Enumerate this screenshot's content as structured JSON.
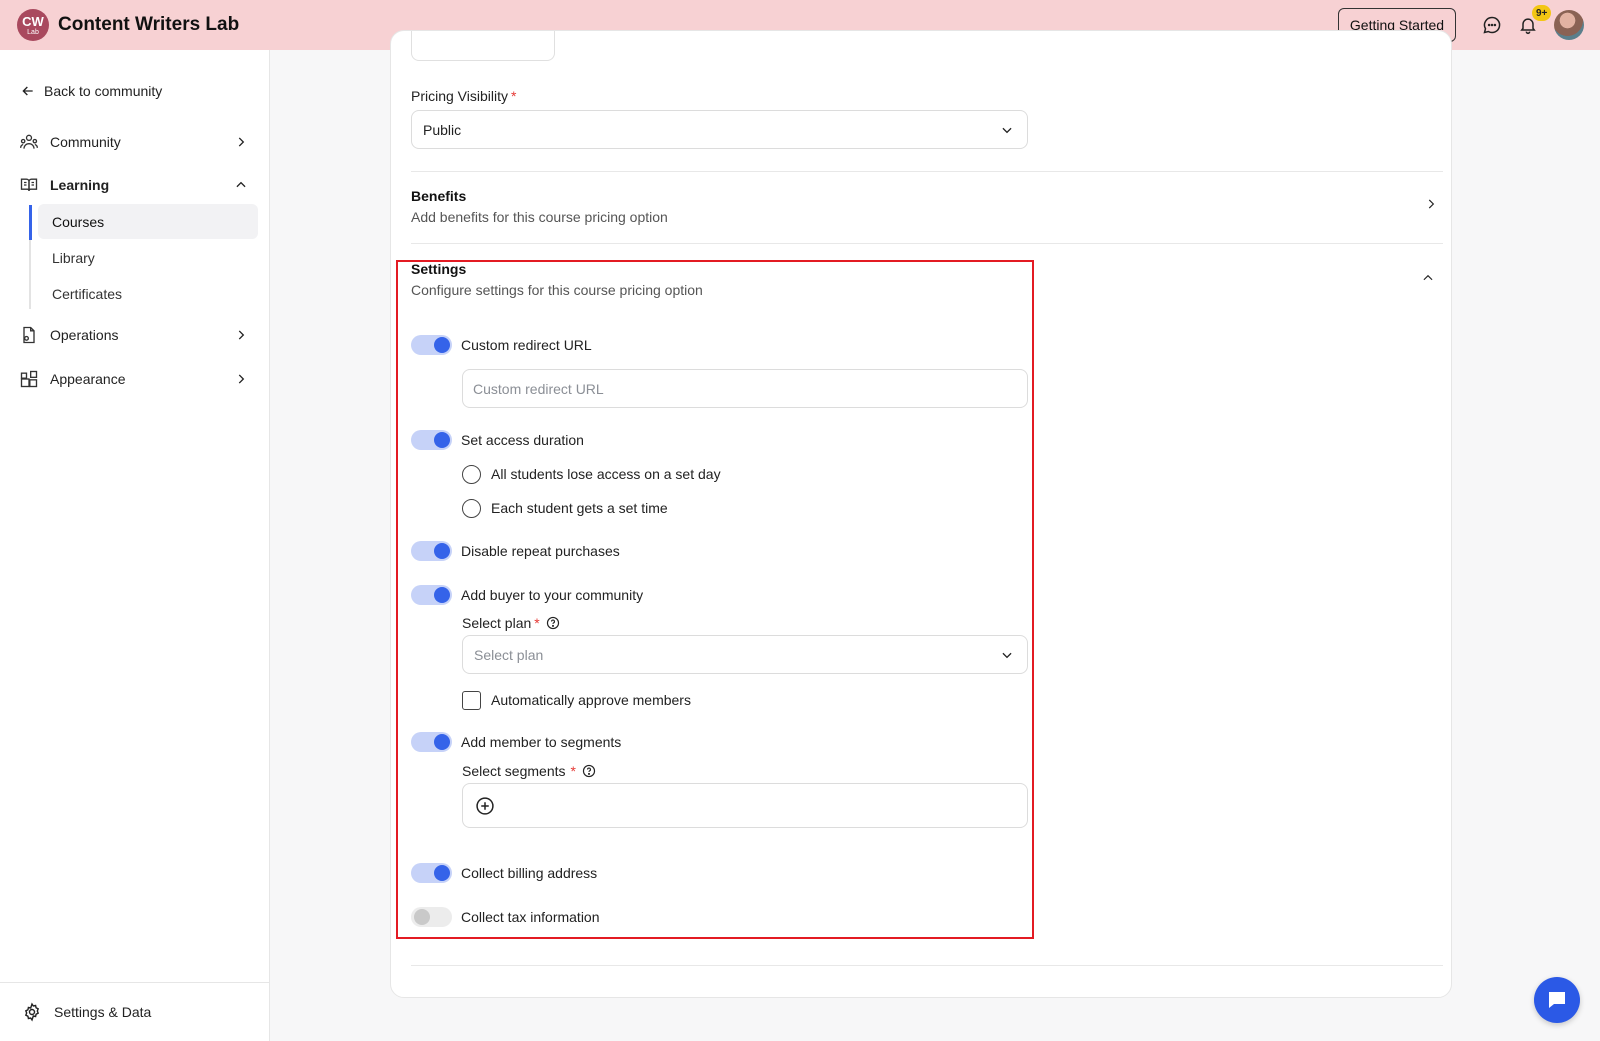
{
  "header": {
    "logo_line1": "CW",
    "logo_line2": "Lab",
    "app_title": "Content Writers Lab",
    "getting_started_label": "Getting Started",
    "notification_badge": "9+"
  },
  "sidebar": {
    "back_label": "Back to community",
    "items": {
      "community": "Community",
      "learning": "Learning",
      "operations": "Operations",
      "appearance": "Appearance"
    },
    "learning_sub": {
      "courses": "Courses",
      "library": "Library",
      "certificates": "Certificates"
    },
    "settings_label": "Settings & Data"
  },
  "form": {
    "pricing_visibility": {
      "label": "Pricing Visibility",
      "required_mark": "*",
      "value": "Public"
    },
    "benefits": {
      "title": "Benefits",
      "subtitle": "Add benefits for this course pricing option"
    },
    "settings": {
      "title": "Settings",
      "subtitle": "Configure settings for this course pricing option",
      "custom_redirect": {
        "label": "Custom redirect URL",
        "enabled": true,
        "placeholder": "Custom redirect URL"
      },
      "access_duration": {
        "label": "Set access duration",
        "enabled": true,
        "option_set_day": "All students lose access on a set day",
        "option_set_time": "Each student gets a set time"
      },
      "disable_repeat": {
        "label": "Disable repeat purchases",
        "enabled": true
      },
      "add_buyer": {
        "label": "Add buyer to your community",
        "enabled": true,
        "plan_label": "Select plan",
        "plan_placeholder": "Select plan",
        "auto_approve_label": "Automatically approve members"
      },
      "add_segments": {
        "label": "Add member to segments",
        "enabled": true,
        "segments_label": "Select segments"
      },
      "billing_address": {
        "label": "Collect billing address",
        "enabled": true
      },
      "tax_info": {
        "label": "Collect tax information",
        "enabled": false
      }
    }
  },
  "colors": {
    "header_bg": "#f7d1d3",
    "accent": "#3563e9",
    "toggle_track_on": "#c6d2f8",
    "highlight_border": "#e31b23",
    "badge": "#f3c614"
  }
}
